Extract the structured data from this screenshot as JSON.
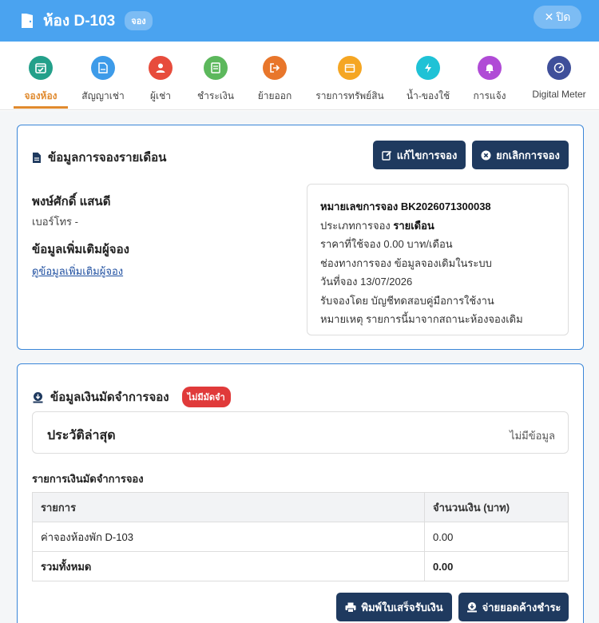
{
  "header": {
    "title": "ห้อง D-103",
    "status": "จอง",
    "close_label": "ปิด"
  },
  "tabs": [
    {
      "label": "จองห้อง",
      "color": "#23a08a",
      "icon": "calendar-check-icon"
    },
    {
      "label": "สัญญาเช่า",
      "color": "#3d9be9",
      "icon": "contract-icon"
    },
    {
      "label": "ผู้เช่า",
      "color": "#e74c3c",
      "icon": "user-icon"
    },
    {
      "label": "ชำระเงิน",
      "color": "#5cb85c",
      "icon": "invoice-icon"
    },
    {
      "label": "ย้ายออก",
      "color": "#e8762b",
      "icon": "move-out-icon"
    },
    {
      "label": "รายการทรัพย์สิน",
      "color": "#f5a623",
      "icon": "box-icon"
    },
    {
      "label": "น้ำ-ของใช้",
      "color": "#1fc2d6",
      "icon": "bolt-icon"
    },
    {
      "label": "การแจ้ง",
      "color": "#b04bd6",
      "icon": "bell-icon"
    },
    {
      "label": "Digital Meter",
      "color": "#3f4f9a",
      "icon": "meter-icon"
    }
  ],
  "booking": {
    "title": "ข้อมูลการจองรายเดือน",
    "edit_label": "แก้ไขการจอง",
    "cancel_label": "ยกเลิกการจอง",
    "name": "พงษ์ศักดิ์ แสนดี",
    "phone": "เบอร์โทร -",
    "extra_title": "ข้อมูลเพิ่มเติมผู้จอง",
    "extra_link": "ดูข้อมูลเพิ่มเติมผู้จอง",
    "details": [
      {
        "label": "หมายเลขการจอง ",
        "value": "BK2026071300038",
        "bold": true
      },
      {
        "label": "ประเภทการจอง ",
        "value": "รายเดือน",
        "bold": true
      },
      {
        "label": "ราคาที่ใช้จอง ",
        "value": "0.00 บาท/เดือน",
        "bold": false
      },
      {
        "label": "ช่องทางการจอง ",
        "value": "ข้อมูลจองเดิมในระบบ",
        "bold": false
      },
      {
        "label": "วันที่จอง ",
        "value": "13/07/2026",
        "bold": false
      },
      {
        "label": "รับจองโดย ",
        "value": "บัญชีทดสอบคู่มือการใช้งาน",
        "bold": false
      },
      {
        "label": "หมายเหตุ ",
        "value": "รายการนี้มาจากสถานะห้องจองเดิม",
        "bold": false
      }
    ]
  },
  "deposit": {
    "title": "ข้อมูลเงินมัดจำการจอง",
    "badge": "ไม่มีมัดจำ",
    "history_title": "ประวัติล่าสุด",
    "history_empty": "ไม่มีข้อมูล",
    "list_title": "รายการเงินมัดจำการจอง",
    "columns": [
      "รายการ",
      "จำนวนเงิน (บาท)"
    ],
    "rows": [
      {
        "item": "ค่าจองห้องพัก D-103",
        "amount": "0.00"
      }
    ],
    "total_label": "รวมทั้งหมด",
    "total_amount": "0.00",
    "print_label": "พิมพ์ใบเสร็จรับเงิน",
    "pay_label": "จ่ายยอดค้างชำระ"
  }
}
